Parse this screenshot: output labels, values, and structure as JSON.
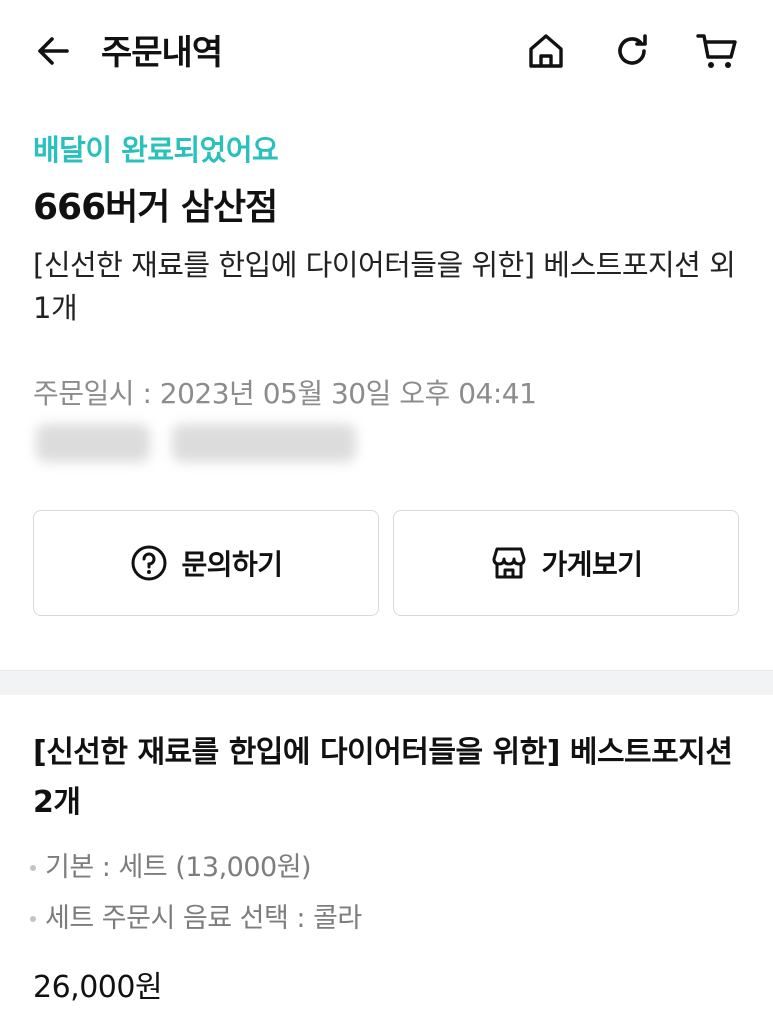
{
  "header": {
    "title": "주문내역",
    "icons": {
      "back": "arrow-left-icon",
      "home": "home-icon",
      "refresh": "refresh-icon",
      "cart": "cart-icon"
    }
  },
  "order": {
    "status": "배달이 완료되었어요",
    "store_name": "666버거 삼산점",
    "summary": "[신선한 재료를 한입에 다이어터들을 위한] 베스트포지션 외 1개",
    "order_date": "주문일시 : 2023년 05월 30일 오후 04:41"
  },
  "actions": {
    "inquiry_label": "문의하기",
    "store_label": "가게보기"
  },
  "menu": {
    "name": "[신선한 재료를 한입에 다이어터들을 위한] 베스트포지션 2개",
    "options": [
      "기본 : 세트 (13,000원)",
      "세트 주문시 음료 선택 : 콜라"
    ],
    "price": "26,000원"
  },
  "colors": {
    "accent": "#2ac1bc",
    "muted_text": "#8c8c8c",
    "border": "#d9d9d9",
    "section_gap": "#f2f3f5"
  }
}
